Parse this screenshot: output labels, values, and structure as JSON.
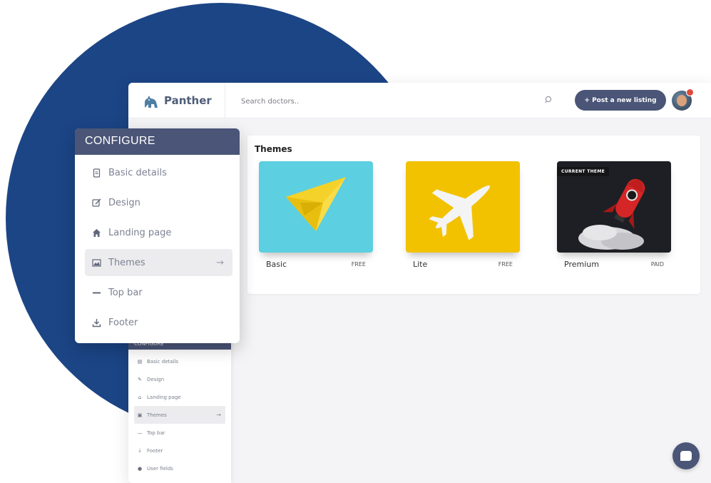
{
  "brand": {
    "name": "Panther"
  },
  "search": {
    "placeholder": "Search doctors.."
  },
  "header": {
    "post_button_label": "+ Post a new listing"
  },
  "themes": {
    "title": "Themes",
    "items": [
      {
        "name": "Basic",
        "price": "FREE"
      },
      {
        "name": "Lite",
        "price": "FREE"
      },
      {
        "name": "Premium",
        "price": "PAID",
        "badge": "CURRENT THEME"
      }
    ]
  },
  "configure": {
    "header": "CONFIGURE",
    "items": [
      {
        "label": "Basic details",
        "icon": "document-icon"
      },
      {
        "label": "Design",
        "icon": "edit-icon"
      },
      {
        "label": "Landing page",
        "icon": "home-icon"
      },
      {
        "label": "Themes",
        "icon": "image-icon",
        "active": true
      },
      {
        "label": "Top bar",
        "icon": "minus-icon"
      },
      {
        "label": "Footer",
        "icon": "download-icon"
      }
    ]
  },
  "sidebar_small": {
    "header": "CONFIGURE",
    "items": [
      {
        "label": "Basic details",
        "icon": "document-icon"
      },
      {
        "label": "Design",
        "icon": "edit-icon"
      },
      {
        "label": "Landing page",
        "icon": "home-icon"
      },
      {
        "label": "Themes",
        "icon": "image-icon",
        "active": true
      },
      {
        "label": "Top bar",
        "icon": "minus-icon"
      },
      {
        "label": "Footer",
        "icon": "download-icon"
      },
      {
        "label": "User fields",
        "icon": "user-icon"
      }
    ]
  },
  "colors": {
    "accent": "#4a5577",
    "background_circle": "#1c4586",
    "basic_theme": "#5ccfe0",
    "lite_theme": "#f2c200",
    "premium_theme": "#1e1f24"
  }
}
